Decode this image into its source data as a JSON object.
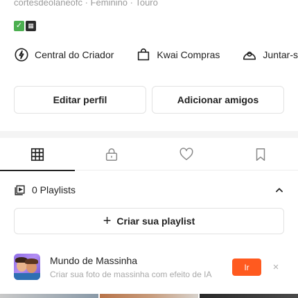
{
  "profile": {
    "info_line": "cortesdeolaneofc · Feminino · Touro",
    "emojis": [
      "check-mark-emoji",
      "clapperboard-emoji"
    ]
  },
  "shortcuts": [
    {
      "label": "Central do Criador",
      "icon": "lightning-circle-icon"
    },
    {
      "label": "Kwai Compras",
      "icon": "shopping-bag-icon"
    },
    {
      "label": "Juntar-s",
      "icon": "group-icon"
    }
  ],
  "actions": {
    "edit_profile": "Editar perfil",
    "add_friends": "Adicionar amigos"
  },
  "tabs": [
    {
      "icon": "grid-icon",
      "active": true
    },
    {
      "icon": "lock-icon",
      "active": false
    },
    {
      "icon": "heart-icon",
      "active": false
    },
    {
      "icon": "bookmark-icon",
      "active": false
    }
  ],
  "playlists": {
    "label": "0 Playlists",
    "create_label": "Criar sua playlist"
  },
  "promo": {
    "title": "Mundo de Massinha",
    "subtitle": "Criar sua foto de massinha com efeito de IA",
    "button": "Ir",
    "close": "×"
  },
  "colors": {
    "accent": "#ff5a1f",
    "muted_text": "#9a9a9a",
    "divider": "#f4f4f4"
  }
}
